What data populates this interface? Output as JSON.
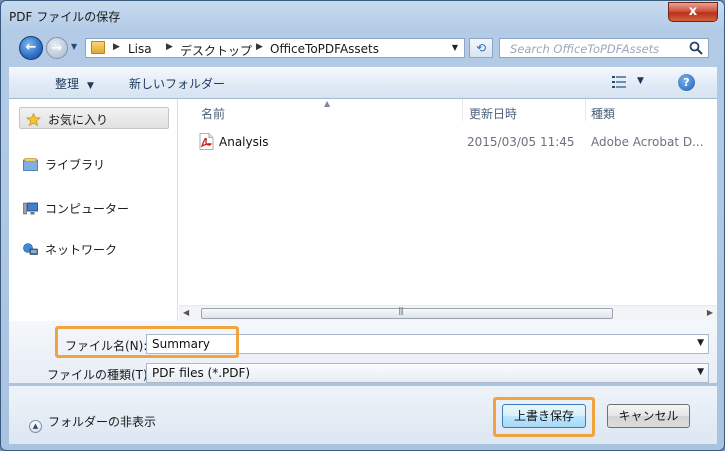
{
  "window": {
    "title": "PDF ファイルの保存",
    "close_label": "x"
  },
  "nav": {
    "back_label": "←",
    "forward_label": "→",
    "breadcrumb": [
      "Lisa",
      "デスクトップ",
      "OfficeToPDFAssets"
    ],
    "search_placeholder": "Search OfficeToPDFAssets"
  },
  "toolbar": {
    "organize": "整理",
    "new_folder": "新しいフォルダー",
    "help": "?"
  },
  "sidebar": {
    "items": [
      {
        "label": "お気に入り",
        "icon": "star-icon"
      },
      {
        "label": "ライブラリ",
        "icon": "library-icon"
      },
      {
        "label": "コンピューター",
        "icon": "computer-icon"
      },
      {
        "label": "ネットワーク",
        "icon": "network-icon"
      }
    ]
  },
  "files": {
    "columns": [
      "名前",
      "更新日時",
      "種類"
    ],
    "rows": [
      {
        "name": "Analysis",
        "modified": "2015/03/05 11:45",
        "type": "Adobe Acrobat D...",
        "icon": "pdf-icon"
      }
    ]
  },
  "form": {
    "filename_label": "ファイル名(N):",
    "filename_value": "Summary",
    "filetype_label": "ファイルの種類(T):",
    "filetype_value": "PDF files (*.PDF)"
  },
  "footer": {
    "hide_folders": "フォルダーの非表示",
    "save": "上書き保存",
    "cancel": "キャンセル"
  },
  "colors": {
    "highlight": "#f1a340",
    "close_red": "#c8412a",
    "accent_blue": "#2e6fc4"
  }
}
